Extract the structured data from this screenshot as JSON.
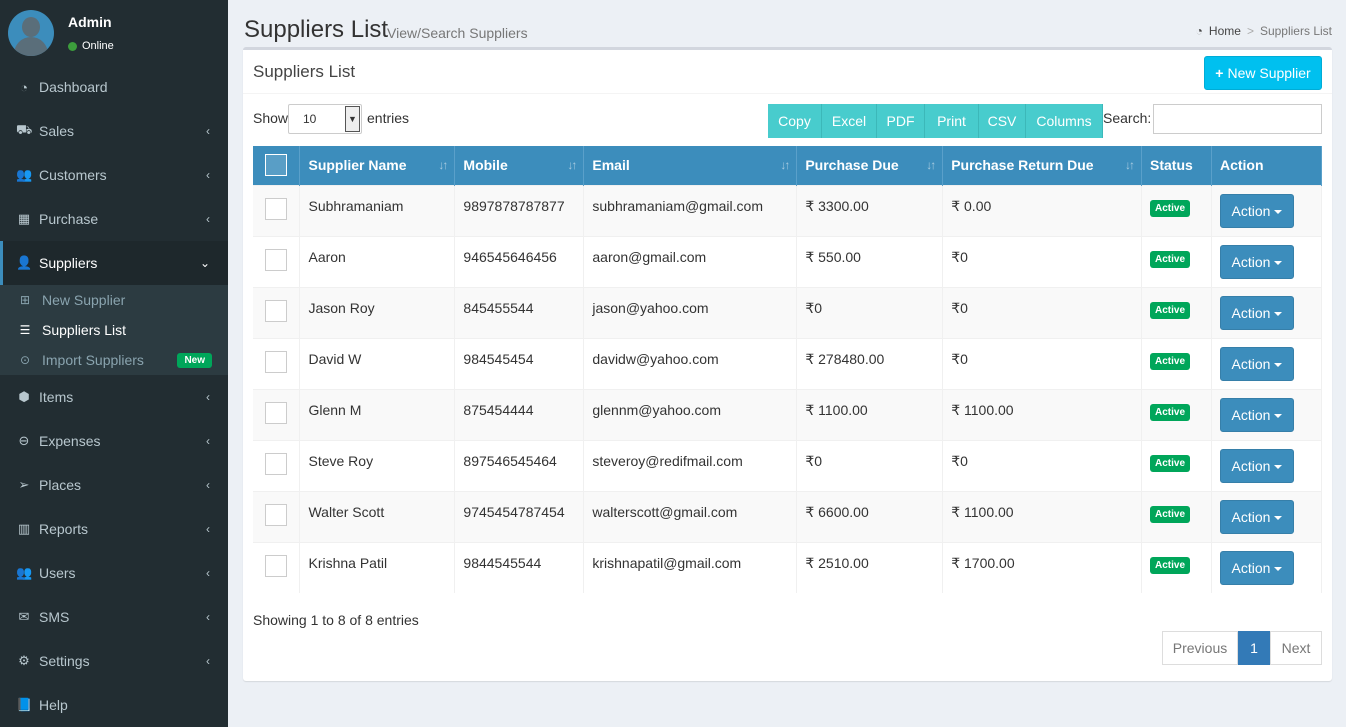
{
  "user": {
    "name": "Admin",
    "status": "Online"
  },
  "sidebar": {
    "items": [
      {
        "label": "Dashboard",
        "icon": "dashboard-icon",
        "glyph": "◔"
      },
      {
        "label": "Sales",
        "icon": "cart-icon",
        "glyph": "⛟"
      },
      {
        "label": "Customers",
        "icon": "users-icon",
        "glyph": "👥"
      },
      {
        "label": "Purchase",
        "icon": "grid-icon",
        "glyph": "▦"
      },
      {
        "label": "Suppliers",
        "icon": "user-plus-icon",
        "glyph": "👤"
      },
      {
        "label": "Items",
        "icon": "cubes-icon",
        "glyph": "⬢"
      },
      {
        "label": "Expenses",
        "icon": "minus-circle-icon",
        "glyph": "⊖"
      },
      {
        "label": "Places",
        "icon": "paper-plane-icon",
        "glyph": "➢"
      },
      {
        "label": "Reports",
        "icon": "bar-chart-icon",
        "glyph": "▥"
      },
      {
        "label": "Users",
        "icon": "users-icon",
        "glyph": "👥"
      },
      {
        "label": "SMS",
        "icon": "envelope-icon",
        "glyph": "✉"
      },
      {
        "label": "Settings",
        "icon": "gears-icon",
        "glyph": "⚙"
      },
      {
        "label": "Help",
        "icon": "book-icon",
        "glyph": "📘"
      }
    ],
    "submenu": [
      {
        "label": "New Supplier",
        "glyph": "⊞"
      },
      {
        "label": "Suppliers List",
        "glyph": "☰"
      },
      {
        "label": "Import Suppliers",
        "glyph": "⊙",
        "badge": "New"
      }
    ]
  },
  "header": {
    "title": "Suppliers List",
    "subtitle": "View/Search Suppliers",
    "breadcrumb": {
      "home": "Home",
      "current": "Suppliers List"
    }
  },
  "box": {
    "title": "Suppliers List",
    "new_button": "New Supplier",
    "show_label": "Show",
    "entries_label": "entries",
    "length_value": "10",
    "search_label": "Search:",
    "export_buttons": [
      "Copy",
      "Excel",
      "PDF",
      "Print",
      "CSV",
      "Columns"
    ],
    "columns": [
      "Supplier Name",
      "Mobile",
      "Email",
      "Purchase Due",
      "Purchase Return Due",
      "Status",
      "Action"
    ],
    "rows": [
      {
        "name": "Subhramaniam",
        "mobile": "9897878787877",
        "email": "subhramaniam@gmail.com",
        "purchase_due": "₹ 3300.00",
        "return_due": "₹ 0.00",
        "status": "Active",
        "action": "Action"
      },
      {
        "name": "Aaron",
        "mobile": "946545646456",
        "email": "aaron@gmail.com",
        "purchase_due": "₹ 550.00",
        "return_due": "₹0",
        "status": "Active",
        "action": "Action"
      },
      {
        "name": "Jason Roy",
        "mobile": "845455544",
        "email": "jason@yahoo.com",
        "purchase_due": "₹0",
        "return_due": "₹0",
        "status": "Active",
        "action": "Action"
      },
      {
        "name": "David W",
        "mobile": "984545454",
        "email": "davidw@yahoo.com",
        "purchase_due": "₹ 278480.00",
        "return_due": "₹0",
        "status": "Active",
        "action": "Action"
      },
      {
        "name": "Glenn M",
        "mobile": "875454444",
        "email": "glennm@yahoo.com",
        "purchase_due": "₹ 1100.00",
        "return_due": "₹ 1100.00",
        "status": "Active",
        "action": "Action"
      },
      {
        "name": "Steve Roy",
        "mobile": "897546545464",
        "email": "steveroy@redifmail.com",
        "purchase_due": "₹0",
        "return_due": "₹0",
        "status": "Active",
        "action": "Action"
      },
      {
        "name": "Walter Scott",
        "mobile": "9745454787454",
        "email": "walterscott@gmail.com",
        "purchase_due": "₹ 6600.00",
        "return_due": "₹ 1100.00",
        "status": "Active",
        "action": "Action"
      },
      {
        "name": "Krishna Patil",
        "mobile": "9844545544",
        "email": "krishnapatil@gmail.com",
        "purchase_due": "₹ 2510.00",
        "return_due": "₹ 1700.00",
        "status": "Active",
        "action": "Action"
      }
    ],
    "info": "Showing 1 to 8 of 8 entries",
    "pagination": {
      "previous": "Previous",
      "current": "1",
      "next": "Next"
    }
  },
  "colors": {
    "sidebar_bg": "#222d32",
    "primary": "#3c8dbc",
    "info": "#00c0ef",
    "success": "#00a65a",
    "teal": "#48cccd"
  }
}
